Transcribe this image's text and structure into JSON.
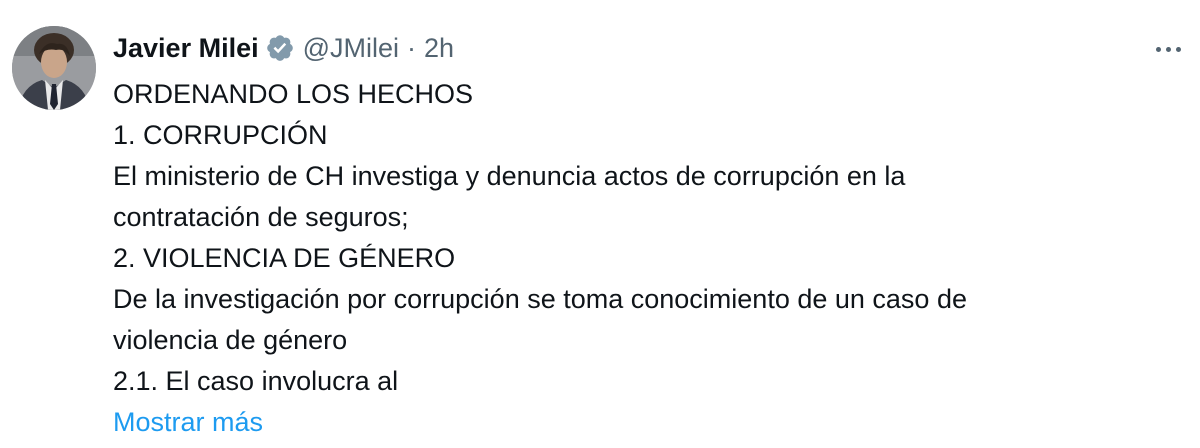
{
  "tweet": {
    "author": {
      "display_name": "Javier Milei",
      "verified_icon": "verified-badge-icon",
      "handle": "@JMilei",
      "separator": "·",
      "time": "2h"
    },
    "more_icon": "more-horizontal-icon",
    "lines": [
      "ORDENANDO LOS HECHOS",
      "1. CORRUPCIÓN",
      "El ministerio de CH investiga y denuncia actos de corrupción en la",
      "contratación de seguros;",
      "2. VIOLENCIA DE GÉNERO",
      "De la investigación por corrupción se toma conocimiento de un caso de",
      "violencia de género",
      "2.1. El caso involucra al"
    ],
    "show_more": "Mostrar más"
  },
  "colors": {
    "text_primary": "#0f1419",
    "text_secondary": "#536471",
    "link": "#1d9bf0",
    "verified_badge": "#829aab"
  }
}
